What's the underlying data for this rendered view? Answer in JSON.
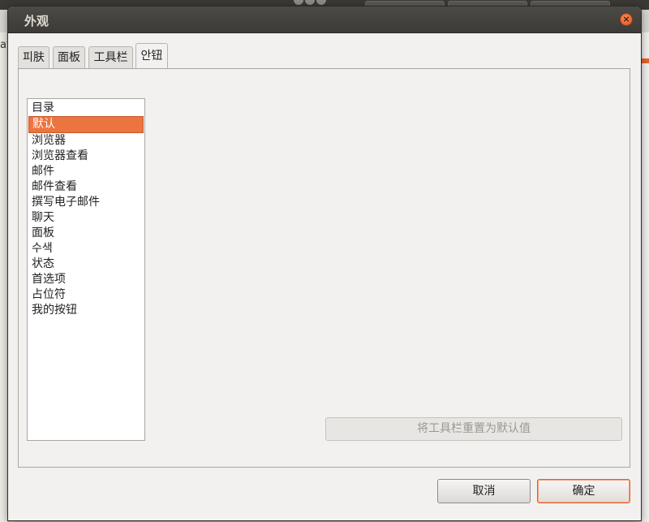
{
  "window": {
    "title": "外观",
    "close_symbol": "×"
  },
  "tabs": [
    {
      "label": "피肤",
      "active": false
    },
    {
      "label": "面板",
      "active": false
    },
    {
      "label": "工具栏",
      "active": false
    },
    {
      "label": "안钮",
      "active": true
    }
  ],
  "list": {
    "items": [
      {
        "label": "目录",
        "selected": false
      },
      {
        "label": "默认",
        "selected": true
      },
      {
        "label": "浏览器",
        "selected": false
      },
      {
        "label": "浏览器查看",
        "selected": false
      },
      {
        "label": "邮件",
        "selected": false
      },
      {
        "label": "邮件查看",
        "selected": false
      },
      {
        "label": "撰写电子邮件",
        "selected": false
      },
      {
        "label": "聊天",
        "selected": false
      },
      {
        "label": "面板",
        "selected": false
      },
      {
        "label": "수색",
        "selected": false
      },
      {
        "label": "状态",
        "selected": false
      },
      {
        "label": "首选项",
        "selected": false
      },
      {
        "label": "占位符",
        "selected": false
      },
      {
        "label": "我的按钮",
        "selected": false
      }
    ]
  },
  "reset_button": {
    "label": "将工具栏重置为默认值",
    "enabled": false
  },
  "footer": {
    "cancel_label": "取消",
    "ok_label": "确定"
  },
  "colors": {
    "accent": "#ec7440",
    "titlebar": "#3c3b37",
    "close": "#e2531b"
  },
  "background": {
    "left_text": "at"
  }
}
